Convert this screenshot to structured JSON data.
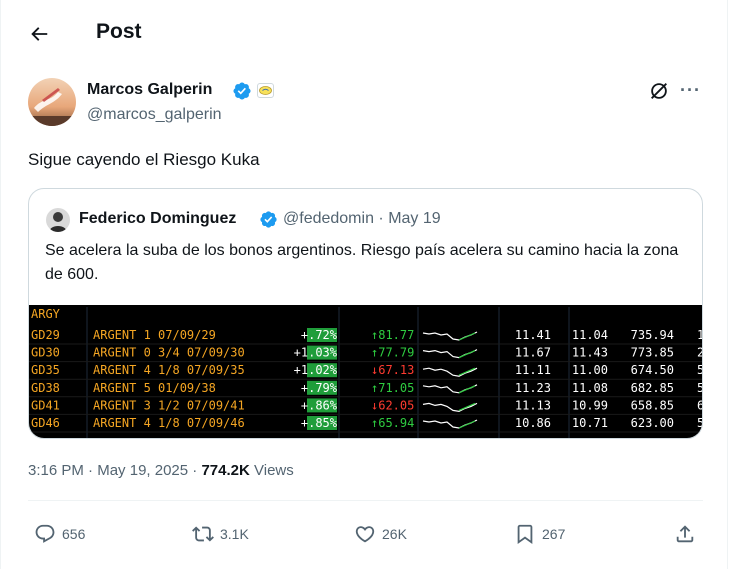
{
  "header": {
    "title": "Post"
  },
  "author": {
    "name": "Marcos Galperin",
    "handle": "@marcos_galperin"
  },
  "post": {
    "text": "Sigue cayendo el Riesgo Kuka"
  },
  "quote": {
    "name": "Federico Dominguez",
    "handle": "@fededomin",
    "date": "May 19",
    "text": "Se acelera la suba de los bonos argentinos. Riesgo país acelera su camino hacia la zona de 600.",
    "terminal": {
      "header": "ARGY",
      "rows": [
        {
          "ticker": "GD29",
          "desc": "ARGENT 1 07/09/29",
          "chg": "+.72%",
          "arrow": "up",
          "price": "81.77",
          "a": "11.41",
          "b": "11.04",
          "c": "735.94",
          "d": "1"
        },
        {
          "ticker": "GD30",
          "desc": "ARGENT 0 3/4 07/09/30",
          "chg": "+1.03%",
          "arrow": "up",
          "price": "77.79",
          "a": "11.67",
          "b": "11.43",
          "c": "773.85",
          "d": "2"
        },
        {
          "ticker": "GD35",
          "desc": "ARGENT 4 1/8 07/09/35",
          "chg": "+1.02%",
          "arrow": "down",
          "price": "67.13",
          "a": "11.11",
          "b": "11.00",
          "c": "674.50",
          "d": "5"
        },
        {
          "ticker": "GD38",
          "desc": "ARGENT 5 01/09/38",
          "chg": "+.79%",
          "arrow": "up",
          "price": "71.05",
          "a": "11.23",
          "b": "11.08",
          "c": "682.85",
          "d": "5"
        },
        {
          "ticker": "GD41",
          "desc": "ARGENT 3 1/2 07/09/41",
          "chg": "+.86%",
          "arrow": "down",
          "price": "62.05",
          "a": "11.13",
          "b": "10.99",
          "c": "658.85",
          "d": "6"
        },
        {
          "ticker": "GD46",
          "desc": "ARGENT 4 1/8 07/09/46",
          "chg": "+.85%",
          "arrow": "up",
          "price": "65.94",
          "a": "10.86",
          "b": "10.71",
          "c": "623.00",
          "d": "5"
        }
      ]
    }
  },
  "meta": {
    "time": "3:16 PM",
    "separator": " · ",
    "date": "May 19, 2025",
    "views_count": "774.2K",
    "views_label": " Views"
  },
  "actions": {
    "replies": "656",
    "reposts": "3.1K",
    "likes": "26K",
    "bookmarks": "267"
  },
  "colors": {
    "accent": "#1d9bf0",
    "muted": "#536471",
    "terminal_orange": "#f5a623",
    "terminal_green": "#2ecc40",
    "terminal_red": "#ff3b30"
  },
  "icons": [
    "back-arrow-icon",
    "verified-badge-icon",
    "affiliate-badge-icon",
    "grok-icon",
    "more-icon",
    "reply-icon",
    "repost-icon",
    "like-icon",
    "bookmark-icon",
    "share-icon"
  ]
}
